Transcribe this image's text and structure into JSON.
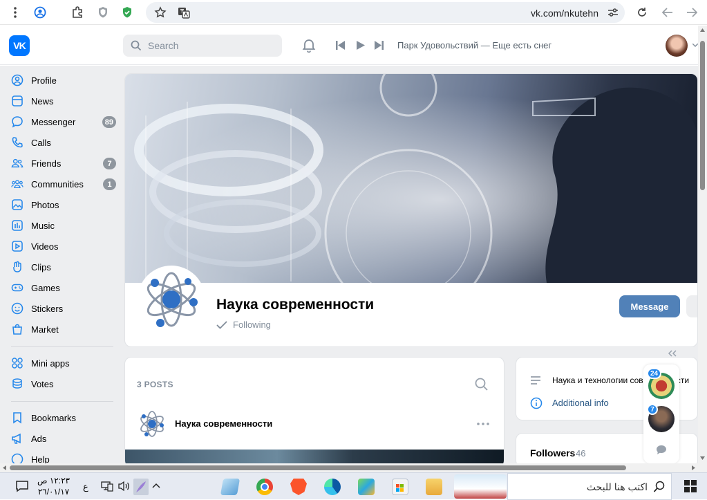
{
  "browser": {
    "url": "vk.com/nkutehn"
  },
  "header": {
    "search_placeholder": "Search",
    "now_playing": "Парк Удовольствий — Еще есть снег"
  },
  "nav": {
    "items": [
      {
        "label": "Profile"
      },
      {
        "label": "News"
      },
      {
        "label": "Messenger",
        "badge": "89"
      },
      {
        "label": "Calls"
      },
      {
        "label": "Friends",
        "badge": "7"
      },
      {
        "label": "Communities",
        "badge": "1"
      },
      {
        "label": "Photos"
      },
      {
        "label": "Music"
      },
      {
        "label": "Videos"
      },
      {
        "label": "Clips"
      },
      {
        "label": "Games"
      },
      {
        "label": "Stickers"
      },
      {
        "label": "Market"
      },
      {
        "label": "Mini apps"
      },
      {
        "label": "Votes"
      },
      {
        "label": "Bookmarks"
      },
      {
        "label": "Ads"
      },
      {
        "label": "Help"
      }
    ]
  },
  "group": {
    "title": "Наука современности",
    "following_label": "Following",
    "message_button": "Message"
  },
  "posts": {
    "count_label": "3 POSTS",
    "author": "Наука современности"
  },
  "info": {
    "description": "Наука и технологии современности",
    "additional_info": "Additional info"
  },
  "followers": {
    "label": "Followers",
    "count": "46"
  },
  "chats": {
    "badges": [
      "24",
      "7"
    ]
  },
  "taskbar": {
    "search_placeholder": "اكتب هنا للبحث",
    "time": "١٢:٢٣ ص",
    "date": "٢٦/٠١/١٧",
    "lang": "ع"
  },
  "colors": {
    "vk_blue": "#0077ff",
    "accent": "#2688eb",
    "message_button": "#5181b8"
  }
}
